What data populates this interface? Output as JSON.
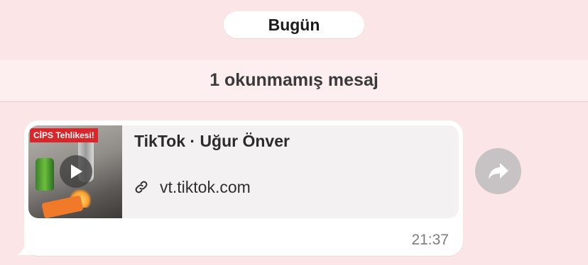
{
  "date_divider": {
    "label": "Bugün"
  },
  "unread_divider": {
    "label": "1 okunmamış mesaj"
  },
  "message": {
    "preview": {
      "thumbnail_caption": "CİPS Tehlikesi!",
      "title": "TikTok · Uğur Önver",
      "link": "vt.tiktok.com"
    },
    "time": "21:37"
  },
  "icons": {
    "play": "play-icon",
    "link": "link-icon",
    "forward": "forward-icon"
  },
  "colors": {
    "background": "#fbe5e6",
    "bubble": "#ffffff",
    "preview_card": "#f4f1f2",
    "thumbnail_label": "#d8262b",
    "forward_button": "#c7c3c4"
  }
}
